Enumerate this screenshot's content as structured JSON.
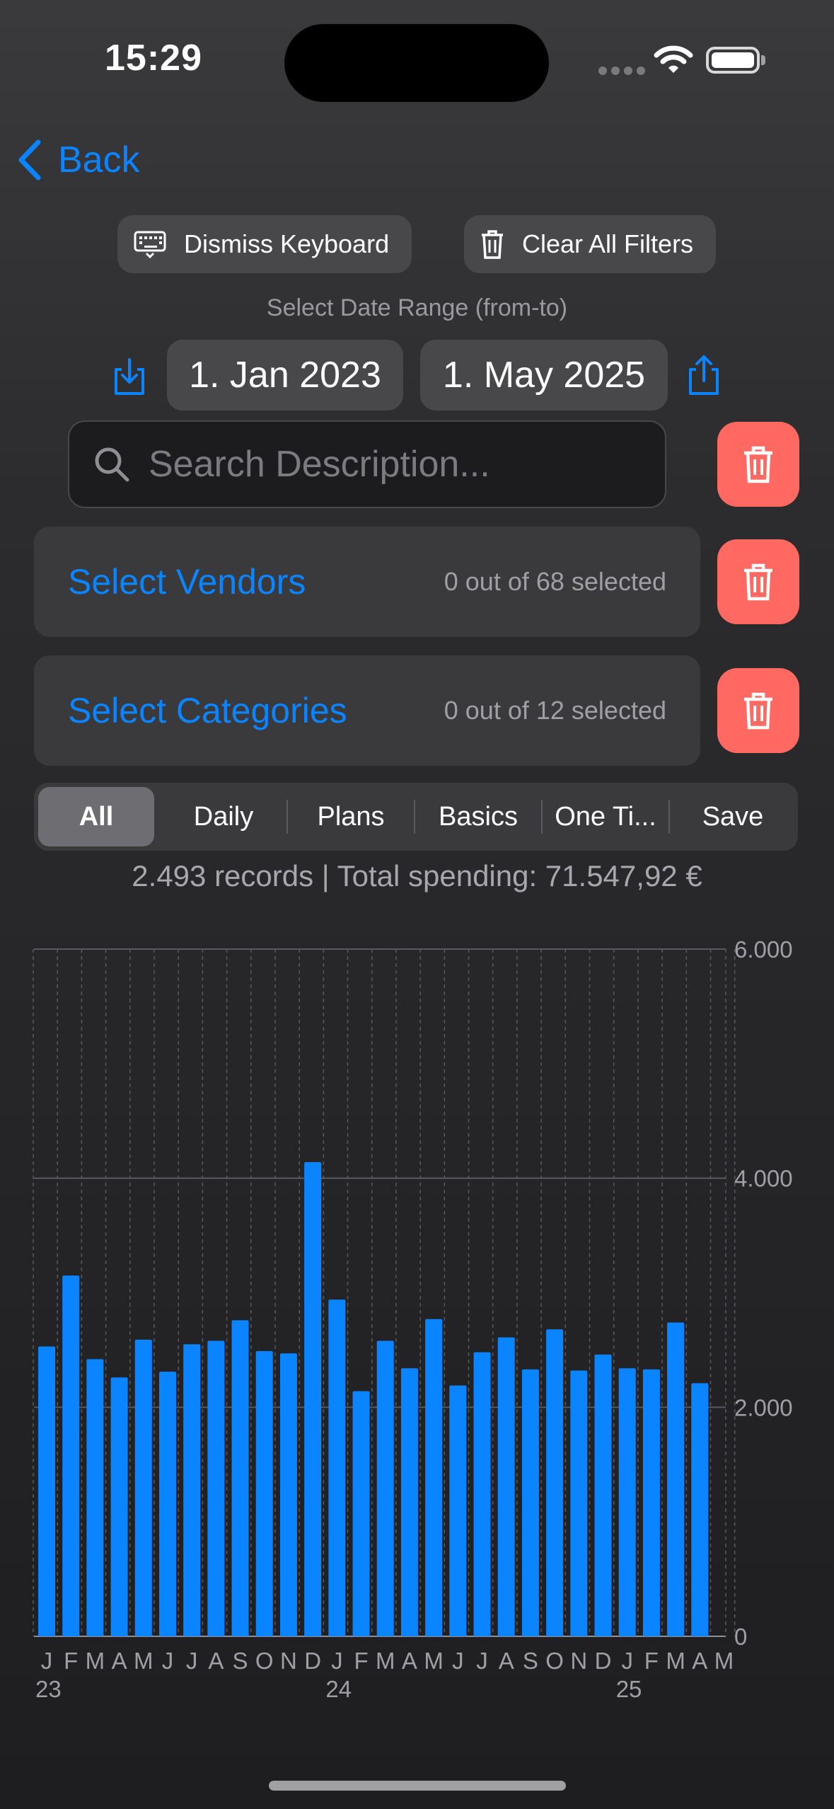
{
  "status": {
    "time": "15:29"
  },
  "nav": {
    "back_label": "Back"
  },
  "toolbar": {
    "dismiss_label": "Dismiss Keyboard",
    "clear_label": "Clear All Filters"
  },
  "date_range": {
    "caption": "Select Date Range (from-to)",
    "from": "1. Jan 2023",
    "to": "1. May 2025"
  },
  "search": {
    "placeholder": "Search Description..."
  },
  "vendors": {
    "title": "Select Vendors",
    "count": "0 out of 68 selected"
  },
  "categories": {
    "title": "Select Categories",
    "count": "0 out of 12 selected"
  },
  "segments": {
    "items": [
      "All",
      "Daily",
      "Plans",
      "Basics",
      "One Ti...",
      "Save"
    ],
    "selected": "All"
  },
  "summary": {
    "text": "2.493 records | Total spending: 71.547,92 €"
  },
  "colors": {
    "accent": "#0a84ff",
    "delete": "#ff6961",
    "bar": "#0a84ff"
  },
  "chart_data": {
    "type": "bar",
    "categories": [
      "J",
      "F",
      "M",
      "A",
      "M",
      "J",
      "J",
      "A",
      "S",
      "O",
      "N",
      "D",
      "J",
      "F",
      "M",
      "A",
      "M",
      "J",
      "J",
      "A",
      "S",
      "O",
      "N",
      "D",
      "J",
      "F",
      "M",
      "A",
      "M"
    ],
    "year_labels": [
      {
        "index": 0,
        "label": "23"
      },
      {
        "index": 12,
        "label": "24"
      },
      {
        "index": 24,
        "label": "25"
      }
    ],
    "series": [
      {
        "values": [
          2530,
          3150,
          2420,
          2260,
          2590,
          2310,
          2550,
          2580,
          2760,
          2490,
          2470,
          4140,
          2940,
          2140,
          2580,
          2340,
          2770,
          2190,
          2480,
          2610,
          2330,
          2680,
          2320,
          2460,
          2340,
          2330,
          2740,
          2210,
          0
        ]
      }
    ],
    "y_ticks": [
      "0",
      "2.000",
      "4.000",
      "6.000"
    ],
    "ylim": [
      0,
      6000
    ],
    "grid": true,
    "y_axis_side": "right"
  }
}
